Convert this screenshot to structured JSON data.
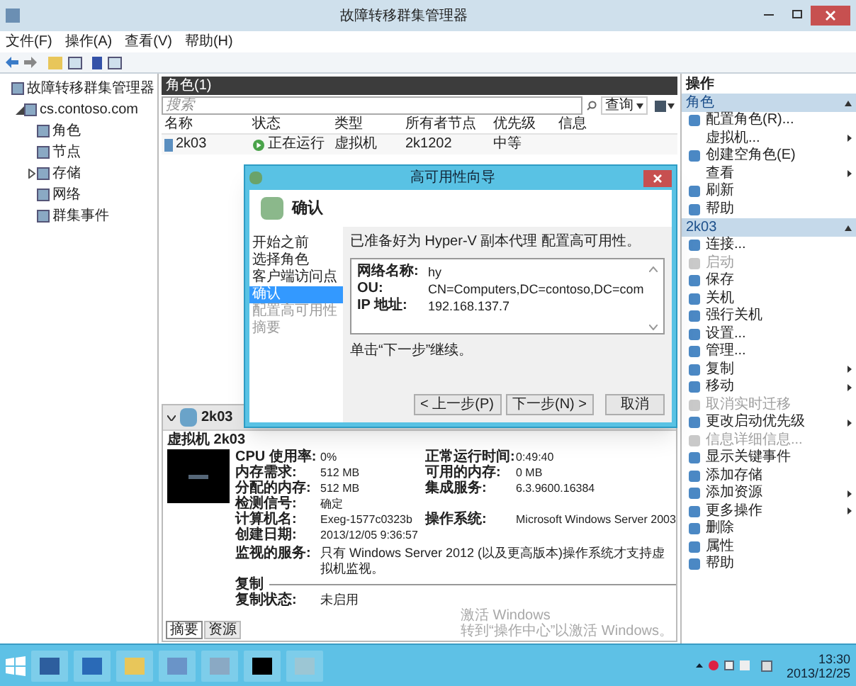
{
  "window": {
    "title": "故障转移群集管理器"
  },
  "menu": [
    "文件(F)",
    "操作(A)",
    "查看(V)",
    "帮助(H)"
  ],
  "tree": {
    "label": "故障转移群集管理器",
    "children": [
      {
        "label": "cs.contoso.com",
        "expanded": true,
        "children": [
          {
            "label": "角色"
          },
          {
            "label": "节点"
          },
          {
            "label": "存储",
            "expanded": false
          },
          {
            "label": "网络"
          },
          {
            "label": "群集事件"
          }
        ]
      }
    ]
  },
  "roles": {
    "title": "角色(1)",
    "search": {
      "placeholder": "搜索"
    },
    "query": "查询",
    "columns": [
      "名称",
      "状态",
      "类型",
      "所有者节点",
      "优先级",
      "信息"
    ],
    "rows": [
      {
        "cells": [
          "2k03",
          "正在运行",
          "虚拟机",
          "2k1202",
          "中等",
          ""
        ]
      }
    ]
  },
  "details": {
    "name": "2k03",
    "vm_title": "虚拟机 2k03",
    "rows": [
      {
        "cells": [
          "CPU 使用率:",
          "0%",
          "正常运行时间:",
          "0:49:40"
        ]
      },
      {
        "cells": [
          "内存需求:",
          "512 MB",
          "可用的内存:",
          "0 MB"
        ]
      },
      {
        "cells": [
          "分配的内存:",
          "512 MB",
          "集成服务:",
          "6.3.9600.16384"
        ]
      },
      {
        "cells": [
          "检测信号:",
          "确定"
        ]
      },
      {
        "cells": [
          "计算机名:",
          "Exeg-1577c0323b",
          "操作系统:",
          "Microsoft Windows Server 2003"
        ]
      },
      {
        "cells": [
          "创建日期:",
          "2013/12/05 9:36:57"
        ]
      }
    ],
    "monitor_label": "监视的服务:",
    "monitor_text": "只有 Windows Server 2012 (以及更高版本)操作系统才支持虚拟机监视。",
    "replication_heading": "复制",
    "replication_label": "复制状态:",
    "replication_value": "未启用",
    "tabs": [
      {
        "label": "摘要",
        "selected": true
      },
      {
        "label": "资源",
        "selected": false
      }
    ],
    "activation": [
      "激活 Windows",
      "转到“操作中心”以激活 Windows。"
    ]
  },
  "actions": {
    "title": "操作",
    "sections": [
      {
        "title": "角色",
        "items": [
          {
            "label": "配置角色(R)...",
            "has_icon": true,
            "disabled": false,
            "submenu": false
          },
          {
            "label": "虚拟机...",
            "has_icon": false,
            "disabled": false,
            "submenu": true
          },
          {
            "label": "创建空角色(E)",
            "has_icon": true,
            "disabled": false,
            "submenu": false
          },
          {
            "label": "查看",
            "has_icon": false,
            "disabled": false,
            "submenu": true
          },
          {
            "label": "刷新",
            "has_icon": true,
            "disabled": false,
            "submenu": false
          },
          {
            "label": "帮助",
            "has_icon": true,
            "disabled": false,
            "submenu": false
          }
        ]
      },
      {
        "title": "2k03",
        "items": [
          {
            "label": "连接...",
            "has_icon": true,
            "disabled": false,
            "submenu": false
          },
          {
            "label": "启动",
            "has_icon": true,
            "disabled": true,
            "submenu": false
          },
          {
            "label": "保存",
            "has_icon": true,
            "disabled": false,
            "submenu": false
          },
          {
            "label": "关机",
            "has_icon": true,
            "disabled": false,
            "submenu": false
          },
          {
            "label": "强行关机",
            "has_icon": true,
            "disabled": false,
            "submenu": false
          },
          {
            "label": "设置...",
            "has_icon": true,
            "disabled": false,
            "submenu": false
          },
          {
            "label": "管理...",
            "has_icon": true,
            "disabled": false,
            "submenu": false
          },
          {
            "label": "复制",
            "has_icon": true,
            "disabled": false,
            "submenu": true
          },
          {
            "label": "移动",
            "has_icon": true,
            "disabled": false,
            "submenu": true
          },
          {
            "label": "取消实时迁移",
            "has_icon": true,
            "disabled": true,
            "submenu": false
          },
          {
            "label": "更改启动优先级",
            "has_icon": true,
            "disabled": false,
            "submenu": true
          },
          {
            "label": "信息详细信息...",
            "has_icon": true,
            "disabled": true,
            "submenu": false
          },
          {
            "label": "显示关键事件",
            "has_icon": true,
            "disabled": false,
            "submenu": false
          },
          {
            "label": "添加存储",
            "has_icon": true,
            "disabled": false,
            "submenu": false
          },
          {
            "label": "添加资源",
            "has_icon": true,
            "disabled": false,
            "submenu": true
          },
          {
            "label": "更多操作",
            "has_icon": true,
            "disabled": false,
            "submenu": true
          },
          {
            "label": "删除",
            "has_icon": true,
            "disabled": false,
            "submenu": false
          },
          {
            "label": "属性",
            "has_icon": true,
            "disabled": false,
            "submenu": false
          },
          {
            "label": "帮助",
            "has_icon": true,
            "disabled": false,
            "submenu": false
          }
        ]
      }
    ]
  },
  "dialog": {
    "title": "高可用性向导",
    "heading": "确认",
    "steps": [
      {
        "label": "开始之前",
        "selected": false,
        "disabled": false
      },
      {
        "label": "选择角色",
        "selected": false,
        "disabled": false
      },
      {
        "label": "客户端访问点",
        "selected": false,
        "disabled": false
      },
      {
        "label": "确认",
        "selected": true,
        "disabled": false
      },
      {
        "label": "配置高可用性",
        "selected": false,
        "disabled": true
      },
      {
        "label": "摘要",
        "selected": false,
        "disabled": true
      }
    ],
    "intro": "已准备好为 Hyper-V 副本代理 配置高可用性。",
    "fields": [
      {
        "label": "网络名称:",
        "value": "hy"
      },
      {
        "label": "OU:",
        "value": "CN=Computers,DC=contoso,DC=com"
      },
      {
        "label": "IP 地址:",
        "value": "192.168.137.7"
      }
    ],
    "note": "单击“下一步”继续。",
    "buttons": [
      "< 上一步(P)",
      "下一步(N) >",
      "取消"
    ]
  },
  "taskbar": {
    "time": "13:30",
    "date": "2013/12/25"
  }
}
